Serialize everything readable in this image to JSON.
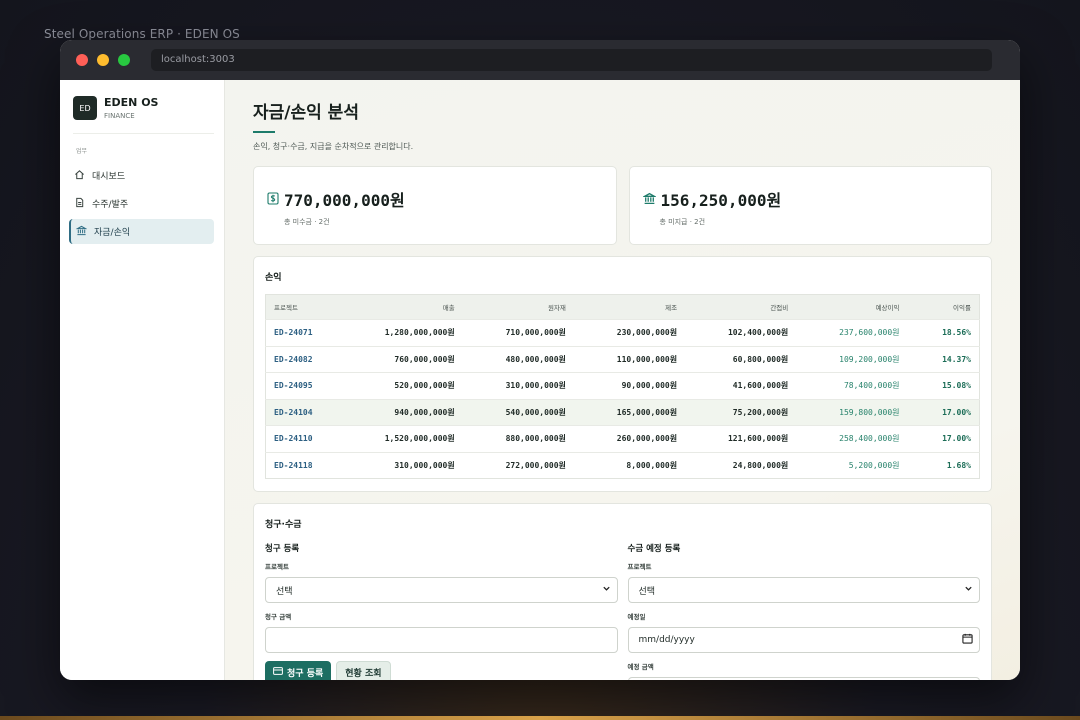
{
  "caption": "Steel Operations ERP · EDEN OS",
  "browser": {
    "url": "localhost:3003"
  },
  "brand": {
    "logo": "ED",
    "name": "EDEN OS",
    "sub": "FINANCE"
  },
  "nav": {
    "section": "업무",
    "items": [
      {
        "label": "대시보드",
        "icon": "home-icon"
      },
      {
        "label": "수주/발주",
        "icon": "document-icon"
      },
      {
        "label": "자금/손익",
        "icon": "bank-icon",
        "active": true
      }
    ]
  },
  "page": {
    "title": "자금/손익 분석",
    "desc": "손익, 청구·수금, 지급을 순차적으로 관리합니다."
  },
  "cards": [
    {
      "icon": "dollar-icon",
      "value": "770,000,000원",
      "sub": "총 미수금 · 2건"
    },
    {
      "icon": "bank-icon",
      "value": "156,250,000원",
      "sub": "총 미지급 · 2건"
    }
  ],
  "pl": {
    "title": "손익",
    "headers": [
      "프로젝트",
      "매출",
      "원자재",
      "제조",
      "간접비",
      "예상이익",
      "이익률"
    ],
    "rows": [
      [
        "ED-24071",
        "1,280,000,000원",
        "710,000,000원",
        "230,000,000원",
        "102,400,000원",
        "237,600,000원",
        "18.56%"
      ],
      [
        "ED-24082",
        "760,000,000원",
        "480,000,000원",
        "110,000,000원",
        "60,800,000원",
        "109,200,000원",
        "14.37%"
      ],
      [
        "ED-24095",
        "520,000,000원",
        "310,000,000원",
        "90,000,000원",
        "41,600,000원",
        "78,400,000원",
        "15.08%"
      ],
      [
        "ED-24104",
        "940,000,000원",
        "540,000,000원",
        "165,000,000원",
        "75,200,000원",
        "159,800,000원",
        "17.00%"
      ],
      [
        "ED-24110",
        "1,520,000,000원",
        "880,000,000원",
        "260,000,000원",
        "121,600,000원",
        "258,400,000원",
        "17.00%"
      ],
      [
        "ED-24118",
        "310,000,000원",
        "272,000,000원",
        "8,000,000원",
        "24,800,000원",
        "5,200,000원",
        "1.68%"
      ]
    ]
  },
  "billing": {
    "title": "청구·수금",
    "left": {
      "heading": "청구 등록",
      "project_label": "프로젝트",
      "project_value": "선택",
      "amount_label": "청구 금액",
      "amount_value": "",
      "submit_label": "청구 등록",
      "status_label": "현황 조회"
    },
    "right": {
      "heading": "수금 예정 등록",
      "project_label": "프로젝트",
      "project_value": "선택",
      "date_label": "예정일",
      "date_placeholder": "mm/dd/yyyy",
      "amount_label": "예정 금액"
    }
  }
}
